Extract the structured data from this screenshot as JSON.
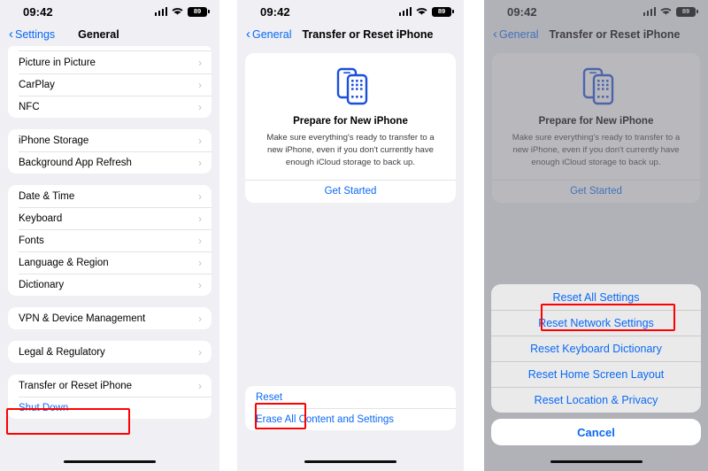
{
  "colors": {
    "accent": "#0a69f5",
    "annotation": "#ff0000",
    "panel_bg": "#efeff4",
    "card_bg": "#ffffff",
    "dim_overlay": "#78788085"
  },
  "status_bar": {
    "time": "09:42",
    "battery_level": "89",
    "signal_icon": "cellular-bars-icon",
    "wifi_icon": "wifi-icon",
    "battery_icon": "battery-icon"
  },
  "panel1": {
    "nav": {
      "back_label": "Settings",
      "title": "General",
      "back_icon": "chevron-left-icon"
    },
    "groups": [
      {
        "partial_top": true,
        "items": [
          {
            "label": "Picture in Picture",
            "accessory": "chevron-right-icon",
            "type": "nav"
          },
          {
            "label": "CarPlay",
            "accessory": "chevron-right-icon",
            "type": "nav"
          },
          {
            "label": "NFC",
            "accessory": "chevron-right-icon",
            "type": "nav"
          }
        ]
      },
      {
        "partial_top": false,
        "items": [
          {
            "label": "iPhone Storage",
            "accessory": "chevron-right-icon",
            "type": "nav"
          },
          {
            "label": "Background App Refresh",
            "accessory": "chevron-right-icon",
            "type": "nav"
          }
        ]
      },
      {
        "partial_top": false,
        "items": [
          {
            "label": "Date & Time",
            "accessory": "chevron-right-icon",
            "type": "nav"
          },
          {
            "label": "Keyboard",
            "accessory": "chevron-right-icon",
            "type": "nav"
          },
          {
            "label": "Fonts",
            "accessory": "chevron-right-icon",
            "type": "nav"
          },
          {
            "label": "Language & Region",
            "accessory": "chevron-right-icon",
            "type": "nav"
          },
          {
            "label": "Dictionary",
            "accessory": "chevron-right-icon",
            "type": "nav"
          }
        ]
      },
      {
        "partial_top": false,
        "items": [
          {
            "label": "VPN & Device Management",
            "accessory": "chevron-right-icon",
            "type": "nav"
          }
        ]
      },
      {
        "partial_top": false,
        "items": [
          {
            "label": "Legal & Regulatory",
            "accessory": "chevron-right-icon",
            "type": "nav"
          }
        ]
      },
      {
        "partial_top": false,
        "items": [
          {
            "label": "Transfer or Reset iPhone",
            "accessory": "chevron-right-icon",
            "type": "nav"
          },
          {
            "label": "Shut Down",
            "accessory": "",
            "type": "link"
          }
        ]
      }
    ],
    "highlight": "Transfer or Reset iPhone"
  },
  "panel2": {
    "nav": {
      "back_label": "General",
      "title": "Transfer or Reset iPhone",
      "back_icon": "chevron-left-icon"
    },
    "prepare_card": {
      "icon": "two-iphones-icon",
      "title": "Prepare for New iPhone",
      "description": "Make sure everything's ready to transfer to a new iPhone, even if you don't currently have enough iCloud storage to back up.",
      "cta_label": "Get Started"
    },
    "bottom_items": [
      {
        "label": "Reset",
        "type": "link"
      },
      {
        "label": "Erase All Content and Settings",
        "type": "link"
      }
    ],
    "highlight": "Reset"
  },
  "panel3": {
    "nav": {
      "back_label": "General",
      "title": "Transfer or Reset iPhone",
      "back_icon": "chevron-left-icon"
    },
    "prepare_card": {
      "icon": "two-iphones-icon",
      "title": "Prepare for New iPhone",
      "description": "Make sure everything's ready to transfer to a new iPhone, even if you don't currently have enough iCloud storage to back up.",
      "cta_label": "Get Started"
    },
    "action_sheet": {
      "options": [
        "Reset All Settings",
        "Reset Network Settings",
        "Reset Keyboard Dictionary",
        "Reset Home Screen Layout",
        "Reset Location & Privacy"
      ],
      "cancel_label": "Cancel"
    },
    "highlight": "Reset Network Settings"
  }
}
